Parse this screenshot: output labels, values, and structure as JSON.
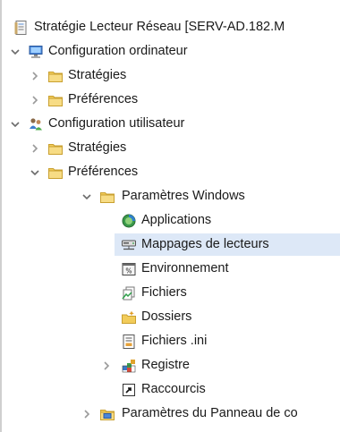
{
  "tree": {
    "root_label": "Stratégie Lecteur Réseau [SERV-AD.182.M",
    "computer_config": {
      "label": "Configuration ordinateur",
      "strategies_label": "Stratégies",
      "preferences_label": "Préférences"
    },
    "user_config": {
      "label": "Configuration utilisateur",
      "strategies_label": "Stratégies",
      "preferences_label": "Préférences",
      "windows_settings_label": "Paramètres Windows",
      "windows_items": [
        {
          "label": "Applications"
        },
        {
          "label": "Mappages de lecteurs"
        },
        {
          "label": "Environnement"
        },
        {
          "label": "Fichiers"
        },
        {
          "label": "Dossiers"
        },
        {
          "label": "Fichiers .ini"
        },
        {
          "label": "Registre"
        },
        {
          "label": "Raccourcis"
        }
      ],
      "control_panel_label": "Paramètres du Panneau de co"
    }
  },
  "selected_item": "Mappages de lecteurs",
  "colors": {
    "selection": "#dde8f7",
    "folder": "#f2cc5a",
    "chevron": "#6b6b6b"
  }
}
